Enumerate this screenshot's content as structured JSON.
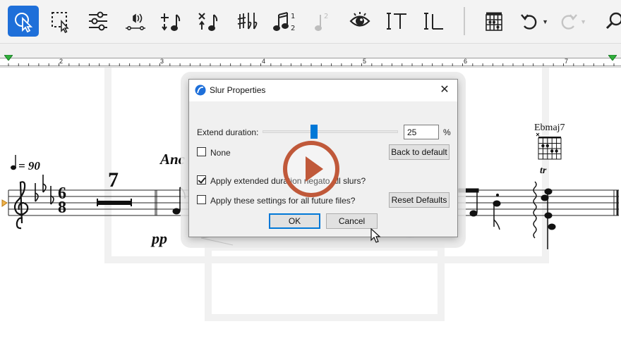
{
  "toolbar": {
    "tools": [
      {
        "name": "select-tool",
        "icon": "pointer-icon",
        "active": true
      },
      {
        "name": "marquee-select-tool",
        "icon": "marquee-select-icon",
        "active": false
      },
      {
        "name": "mixer-tool",
        "icon": "sliders-icon",
        "active": false
      },
      {
        "name": "playback-tool",
        "icon": "speaker-staff-icon",
        "active": false
      },
      {
        "name": "add-note-tool",
        "icon": "plus-note-icon",
        "active": false
      },
      {
        "name": "remove-note-tool",
        "icon": "x-note-icon",
        "active": false
      },
      {
        "name": "accidentals-tool",
        "icon": "sharp-flat-icon",
        "active": false
      },
      {
        "name": "voices-tool",
        "icon": "voice-notes-icon",
        "active": false
      },
      {
        "name": "voice-2-tool",
        "icon": "note-2-disabled-icon",
        "active": false
      },
      {
        "name": "view-tool",
        "icon": "eye-icon",
        "active": false
      },
      {
        "name": "text-tool",
        "icon": "text-cursor-icon",
        "active": false
      },
      {
        "name": "lyrics-tool",
        "icon": "lyrics-cursor-icon",
        "active": false
      },
      {
        "name": "chord-diagram-tool",
        "icon": "chord-grid-icon",
        "active": false
      },
      {
        "name": "undo-button",
        "icon": "undo-icon",
        "active": false
      },
      {
        "name": "redo-button",
        "icon": "redo-icon",
        "active": false
      },
      {
        "name": "search-button",
        "icon": "search-icon",
        "active": false
      }
    ]
  },
  "ruler": {
    "numbers": [
      "2",
      "3",
      "4",
      "5",
      "6",
      "7"
    ]
  },
  "score": {
    "tempo": "= 90",
    "expression": "Anc",
    "time_signature_top": "6",
    "time_signature_bottom": "8",
    "multirest_count": "7",
    "dynamic": "pp",
    "chord_symbol": "Ebmaj7",
    "ornament": "tr"
  },
  "dialog": {
    "title": "Slur Properties",
    "extend_label": "Extend duration:",
    "extend_value": "25",
    "extend_unit": "%",
    "extend_percent": 0.38,
    "none_label": "None",
    "none_checked": false,
    "back_to_default_label": "Back to default",
    "apply_all_label": "Apply extended duration negato all slurs?",
    "apply_all_checked": true,
    "apply_future_label": "Apply these settings for all future files?",
    "apply_future_checked": false,
    "reset_defaults_label": "Reset Defaults",
    "ok_label": "OK",
    "cancel_label": "Cancel"
  },
  "colors": {
    "accent": "#1e6fd9",
    "play_overlay": "#c0593a",
    "ruler_marker": "#2fae3b"
  }
}
